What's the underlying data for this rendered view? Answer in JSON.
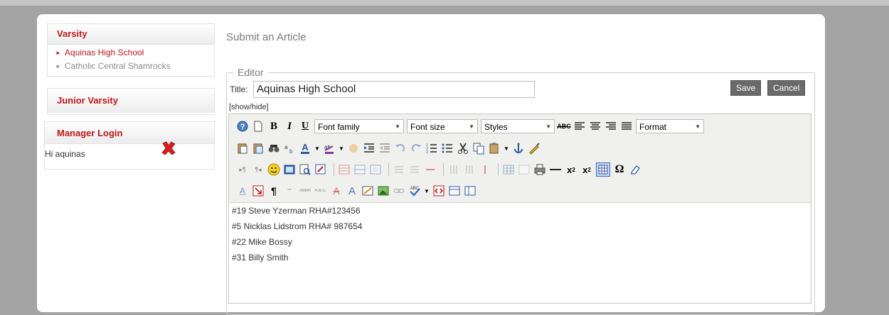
{
  "sidebar": {
    "varsity": {
      "heading": "Varsity",
      "items": [
        {
          "label": "Aquinas High School",
          "active": true
        },
        {
          "label": "Catholic Central Shamrocks",
          "active": false
        }
      ]
    },
    "junior_varsity": {
      "heading": "Junior Varsity"
    },
    "manager_login": {
      "heading": "Manager Login",
      "greeting": "Hi aquinas",
      "logout_icon": "red-x-icon"
    }
  },
  "main": {
    "page_title": "Submit an Article",
    "legend": "Editor",
    "title_label": "Title:",
    "title_value": "Aquinas High School",
    "save_label": "Save",
    "cancel_label": "Cancel",
    "show_hide": "[show/hide]"
  },
  "toolbar": {
    "font_family": "Font family",
    "font_size": "Font size",
    "styles": "Styles",
    "format": "Format"
  },
  "content": {
    "lines": [
      "#19 Steve Yzerman  RHA#123456",
      "#5 Nicklas Lidstrom RHA# 987654",
      "#22 Mike Bossy",
      "#31 Billy Smith"
    ]
  },
  "colors": {
    "accent": "#c0171b",
    "background": "#a3a3a3",
    "button": "#6a6a6a"
  }
}
